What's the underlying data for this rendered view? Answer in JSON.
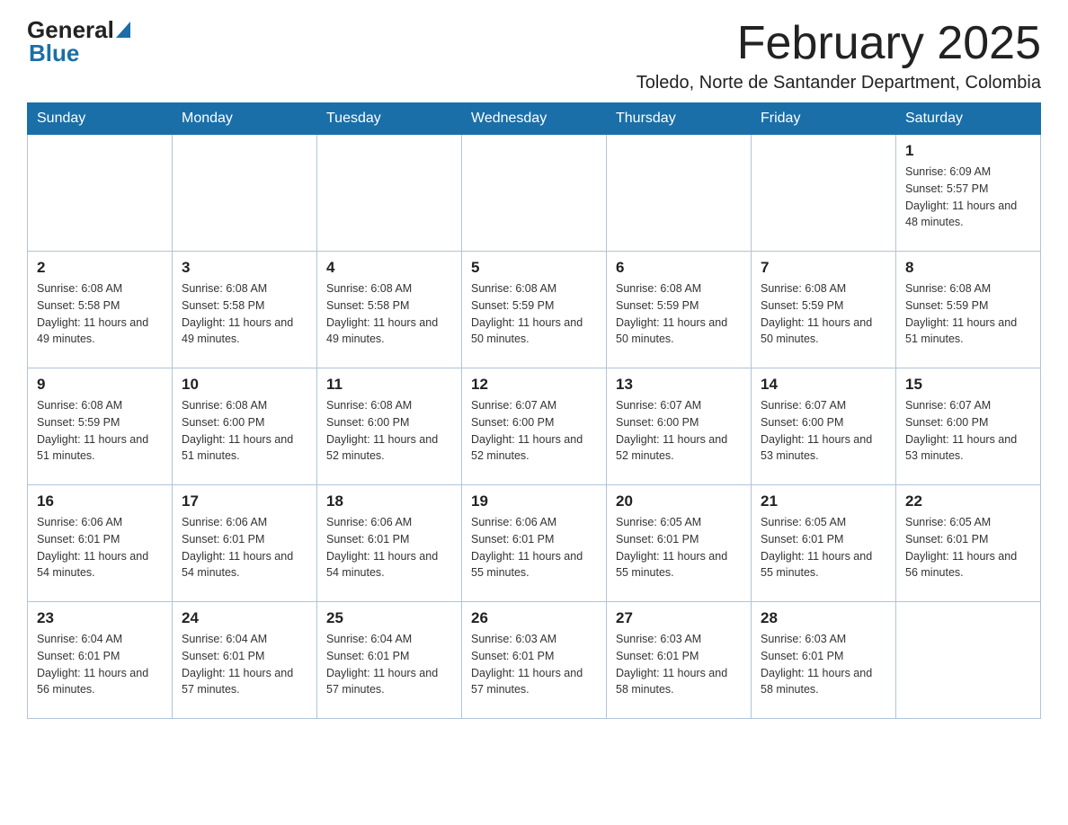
{
  "header": {
    "logo": {
      "general": "General",
      "arrow_color": "#1a6fa8",
      "blue": "Blue"
    },
    "month_title": "February 2025",
    "subtitle": "Toledo, Norte de Santander Department, Colombia"
  },
  "weekdays": [
    "Sunday",
    "Monday",
    "Tuesday",
    "Wednesday",
    "Thursday",
    "Friday",
    "Saturday"
  ],
  "weeks": [
    [
      {
        "day": "",
        "info": ""
      },
      {
        "day": "",
        "info": ""
      },
      {
        "day": "",
        "info": ""
      },
      {
        "day": "",
        "info": ""
      },
      {
        "day": "",
        "info": ""
      },
      {
        "day": "",
        "info": ""
      },
      {
        "day": "1",
        "info": "Sunrise: 6:09 AM\nSunset: 5:57 PM\nDaylight: 11 hours and 48 minutes."
      }
    ],
    [
      {
        "day": "2",
        "info": "Sunrise: 6:08 AM\nSunset: 5:58 PM\nDaylight: 11 hours and 49 minutes."
      },
      {
        "day": "3",
        "info": "Sunrise: 6:08 AM\nSunset: 5:58 PM\nDaylight: 11 hours and 49 minutes."
      },
      {
        "day": "4",
        "info": "Sunrise: 6:08 AM\nSunset: 5:58 PM\nDaylight: 11 hours and 49 minutes."
      },
      {
        "day": "5",
        "info": "Sunrise: 6:08 AM\nSunset: 5:59 PM\nDaylight: 11 hours and 50 minutes."
      },
      {
        "day": "6",
        "info": "Sunrise: 6:08 AM\nSunset: 5:59 PM\nDaylight: 11 hours and 50 minutes."
      },
      {
        "day": "7",
        "info": "Sunrise: 6:08 AM\nSunset: 5:59 PM\nDaylight: 11 hours and 50 minutes."
      },
      {
        "day": "8",
        "info": "Sunrise: 6:08 AM\nSunset: 5:59 PM\nDaylight: 11 hours and 51 minutes."
      }
    ],
    [
      {
        "day": "9",
        "info": "Sunrise: 6:08 AM\nSunset: 5:59 PM\nDaylight: 11 hours and 51 minutes."
      },
      {
        "day": "10",
        "info": "Sunrise: 6:08 AM\nSunset: 6:00 PM\nDaylight: 11 hours and 51 minutes."
      },
      {
        "day": "11",
        "info": "Sunrise: 6:08 AM\nSunset: 6:00 PM\nDaylight: 11 hours and 52 minutes."
      },
      {
        "day": "12",
        "info": "Sunrise: 6:07 AM\nSunset: 6:00 PM\nDaylight: 11 hours and 52 minutes."
      },
      {
        "day": "13",
        "info": "Sunrise: 6:07 AM\nSunset: 6:00 PM\nDaylight: 11 hours and 52 minutes."
      },
      {
        "day": "14",
        "info": "Sunrise: 6:07 AM\nSunset: 6:00 PM\nDaylight: 11 hours and 53 minutes."
      },
      {
        "day": "15",
        "info": "Sunrise: 6:07 AM\nSunset: 6:00 PM\nDaylight: 11 hours and 53 minutes."
      }
    ],
    [
      {
        "day": "16",
        "info": "Sunrise: 6:06 AM\nSunset: 6:01 PM\nDaylight: 11 hours and 54 minutes."
      },
      {
        "day": "17",
        "info": "Sunrise: 6:06 AM\nSunset: 6:01 PM\nDaylight: 11 hours and 54 minutes."
      },
      {
        "day": "18",
        "info": "Sunrise: 6:06 AM\nSunset: 6:01 PM\nDaylight: 11 hours and 54 minutes."
      },
      {
        "day": "19",
        "info": "Sunrise: 6:06 AM\nSunset: 6:01 PM\nDaylight: 11 hours and 55 minutes."
      },
      {
        "day": "20",
        "info": "Sunrise: 6:05 AM\nSunset: 6:01 PM\nDaylight: 11 hours and 55 minutes."
      },
      {
        "day": "21",
        "info": "Sunrise: 6:05 AM\nSunset: 6:01 PM\nDaylight: 11 hours and 55 minutes."
      },
      {
        "day": "22",
        "info": "Sunrise: 6:05 AM\nSunset: 6:01 PM\nDaylight: 11 hours and 56 minutes."
      }
    ],
    [
      {
        "day": "23",
        "info": "Sunrise: 6:04 AM\nSunset: 6:01 PM\nDaylight: 11 hours and 56 minutes."
      },
      {
        "day": "24",
        "info": "Sunrise: 6:04 AM\nSunset: 6:01 PM\nDaylight: 11 hours and 57 minutes."
      },
      {
        "day": "25",
        "info": "Sunrise: 6:04 AM\nSunset: 6:01 PM\nDaylight: 11 hours and 57 minutes."
      },
      {
        "day": "26",
        "info": "Sunrise: 6:03 AM\nSunset: 6:01 PM\nDaylight: 11 hours and 57 minutes."
      },
      {
        "day": "27",
        "info": "Sunrise: 6:03 AM\nSunset: 6:01 PM\nDaylight: 11 hours and 58 minutes."
      },
      {
        "day": "28",
        "info": "Sunrise: 6:03 AM\nSunset: 6:01 PM\nDaylight: 11 hours and 58 minutes."
      },
      {
        "day": "",
        "info": ""
      }
    ]
  ]
}
